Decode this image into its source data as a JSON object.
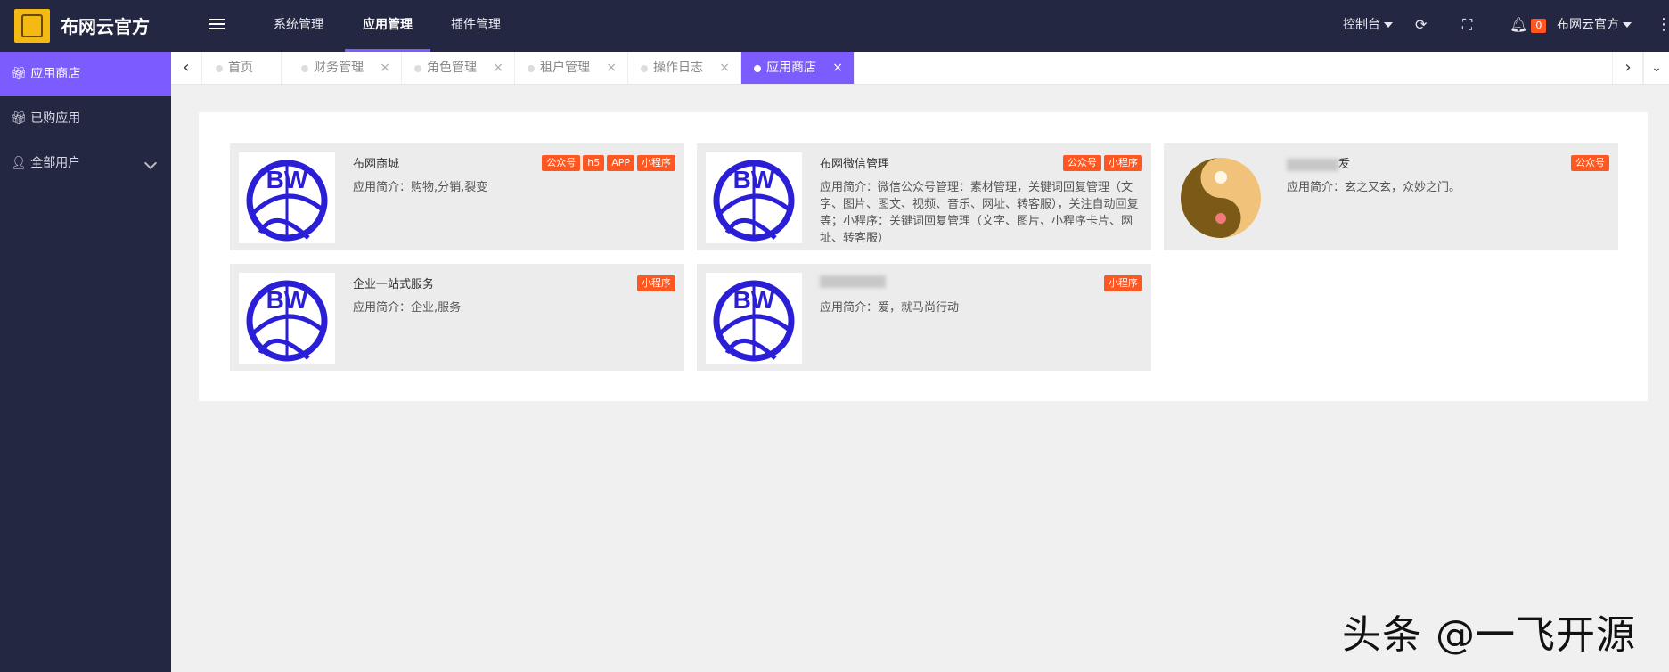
{
  "header": {
    "brand": "布网云官方",
    "nav": [
      "系统管理",
      "应用管理",
      "插件管理"
    ],
    "active_nav": "应用管理",
    "console": "控制台",
    "notif_count": "0",
    "user": "布网云官方"
  },
  "sidebar": {
    "items": [
      {
        "label": "应用商店",
        "icon": "gift-icon"
      },
      {
        "label": "已购应用",
        "icon": "gift-icon"
      },
      {
        "label": "全部用户",
        "icon": "person-icon"
      }
    ]
  },
  "tabs": [
    {
      "label": "首页",
      "closable": false
    },
    {
      "label": "财务管理",
      "closable": true
    },
    {
      "label": "角色管理",
      "closable": true
    },
    {
      "label": "租户管理",
      "closable": true
    },
    {
      "label": "操作日志",
      "closable": true
    },
    {
      "label": "应用商店",
      "closable": true,
      "active": true
    }
  ],
  "cards": [
    {
      "title": "布网商城",
      "desc": "应用简介：购物,分销,裂变",
      "tags": [
        "公众号",
        "h5",
        "APP",
        "小程序"
      ],
      "image": "bw-globe-logo"
    },
    {
      "title": "布网微信管理",
      "desc": "应用简介：微信公众号管理：素材管理，关键词回复管理（文字、图片、图文、视频、音乐、网址、转客服），关注自动回复等；小程序：关键词回复管理（文字、图片、小程序卡片、网址、转客服）",
      "tags": [
        "公众号",
        "小程序"
      ],
      "image": "bw-globe-logo"
    },
    {
      "title": "叐",
      "desc": "应用简介：玄之又玄，众妙之门。",
      "tags": [
        "公众号"
      ],
      "image": "yin-yang-logo"
    },
    {
      "title": "企业一站式服务",
      "desc": "应用简介：企业,服务",
      "tags": [
        "小程序"
      ],
      "image": "bw-globe-logo"
    },
    {
      "title": "",
      "desc": "应用简介：爱，就马尚行动",
      "tags": [
        "小程序"
      ],
      "image": "bw-globe-logo"
    }
  ],
  "watermark": "头条 @一飞开源",
  "colors": {
    "header_bg": "#232741",
    "accent": "#7c5cff",
    "tag": "#ff5722"
  }
}
